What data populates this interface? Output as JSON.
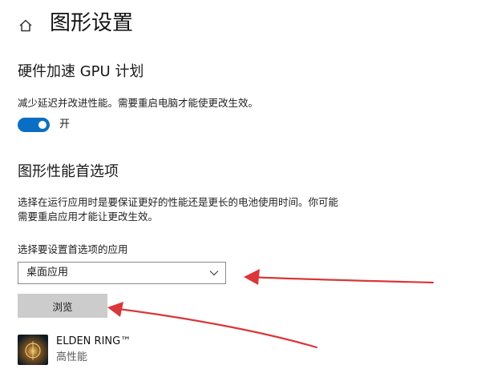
{
  "header": {
    "title": "图形设置",
    "icon": "home-icon"
  },
  "gpu_scheduling": {
    "title": "硬件加速 GPU 计划",
    "description": "减少延迟并改进性能。需要重启电脑才能使更改生效。",
    "toggle_state": "on",
    "toggle_label": "开"
  },
  "graphics_preference": {
    "title": "图形性能首选项",
    "description_line1": "选择在运行应用时是要保证更好的性能还是更长的电池使用时间。你可能",
    "description_line2": "需要重启应用才能让更改生效。",
    "select_label": "选择要设置首选项的应用",
    "select_value": "桌面应用",
    "browse_label": "浏览"
  },
  "apps": [
    {
      "name": "ELDEN RING™",
      "preference": "高性能"
    }
  ],
  "colors": {
    "accent": "#0a6fc4",
    "annotation_arrow": "#d9373a",
    "button_bg": "#cccccc"
  }
}
